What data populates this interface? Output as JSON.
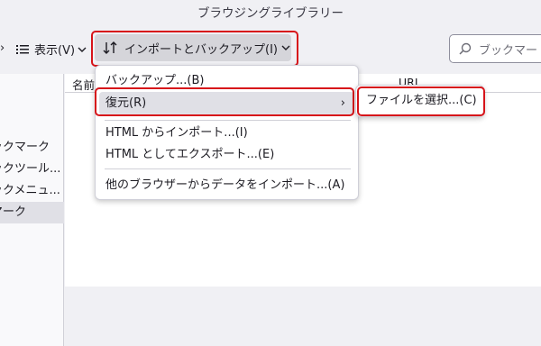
{
  "window": {
    "title": "ブラウジングライブラリー"
  },
  "toolbar": {
    "organize_icon": "chevron-down-icon",
    "views_label": "表示(V)",
    "import_export_label": "インポートとバックアップ(I)",
    "search_placeholder": "ブックマー"
  },
  "sidebar": {
    "items": [
      {
        "label": "ックマーク"
      },
      {
        "label": "ックツール..."
      },
      {
        "label": "ックメニュ..."
      },
      {
        "label": "マーク"
      }
    ]
  },
  "columns": {
    "name": "名前",
    "url": "URL"
  },
  "import_menu": {
    "items": [
      {
        "label": "バックアップ...(B)"
      },
      {
        "label": "復元(R)"
      },
      {
        "label": "HTML からインポート...(I)"
      },
      {
        "label": "HTML としてエクスポート...(E)"
      },
      {
        "label": "他のブラウザーからデータをインポート...(A)"
      }
    ],
    "restore_submenu": {
      "choose_file_label": "ファイルを選択...(C)"
    }
  },
  "colors": {
    "highlight": "#d7141a",
    "selected": "#e0e0e6"
  }
}
